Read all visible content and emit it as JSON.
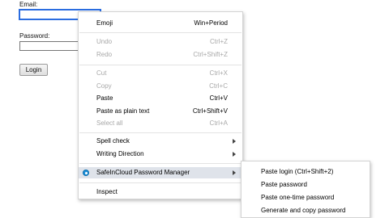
{
  "form": {
    "email_label": "Email:",
    "email_value": "",
    "password_label": "Password:",
    "password_value": "",
    "login_label": "Login"
  },
  "menu": {
    "emoji": {
      "label": "Emoji",
      "shortcut": "Win+Period"
    },
    "undo": {
      "label": "Undo",
      "shortcut": "Ctrl+Z"
    },
    "redo": {
      "label": "Redo",
      "shortcut": "Ctrl+Shift+Z"
    },
    "cut": {
      "label": "Cut",
      "shortcut": "Ctrl+X"
    },
    "copy": {
      "label": "Copy",
      "shortcut": "Ctrl+C"
    },
    "paste": {
      "label": "Paste",
      "shortcut": "Ctrl+V"
    },
    "paste_plain": {
      "label": "Paste as plain text",
      "shortcut": "Ctrl+Shift+V"
    },
    "select_all": {
      "label": "Select all",
      "shortcut": "Ctrl+A"
    },
    "spell_check": {
      "label": "Spell check"
    },
    "writing_direction": {
      "label": "Writing Direction"
    },
    "safeincloud": {
      "label": "SafeInCloud Password Manager"
    },
    "inspect": {
      "label": "Inspect"
    }
  },
  "submenu": {
    "items": [
      "Paste login (Ctrl+Shift+2)",
      "Paste password",
      "Paste one-time password",
      "Generate and copy password"
    ]
  },
  "colors": {
    "highlight": "#dfe3ea",
    "disabled_text": "#a8a8a8",
    "focus_ring": "#2b6de0",
    "safeincloud_icon": "#1c8fd8"
  },
  "icons": {
    "safeincloud": "safeincloud-icon",
    "submenu_arrow": "chevron-right-icon"
  }
}
